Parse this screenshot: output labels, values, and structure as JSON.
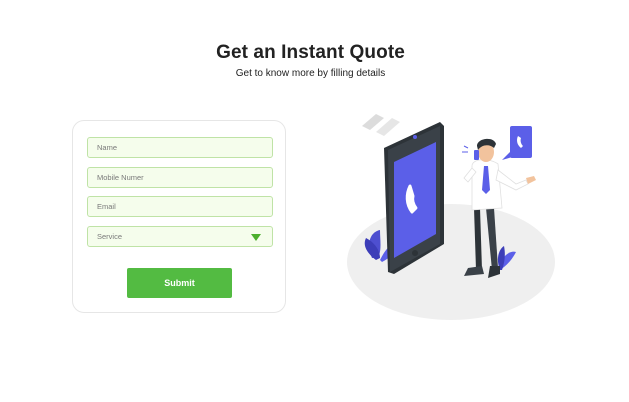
{
  "header": {
    "title": "Get an Instant Quote",
    "subtitle": "Get to know more by filling details"
  },
  "form": {
    "name_placeholder": "Name",
    "mobile_placeholder": "Mobile Numer",
    "email_placeholder": "Email",
    "service_selected": "Service",
    "submit_label": "Submit"
  },
  "colors": {
    "accent_green": "#53bb42",
    "field_border": "#bfe3a6",
    "field_bg": "#f5fdec",
    "illustration_purple": "#5b5fe8",
    "illustration_dark": "#3a4148"
  },
  "icons": {
    "select_arrow": "chevron-down-icon",
    "phone_illustration": "phone-call-illustration"
  }
}
